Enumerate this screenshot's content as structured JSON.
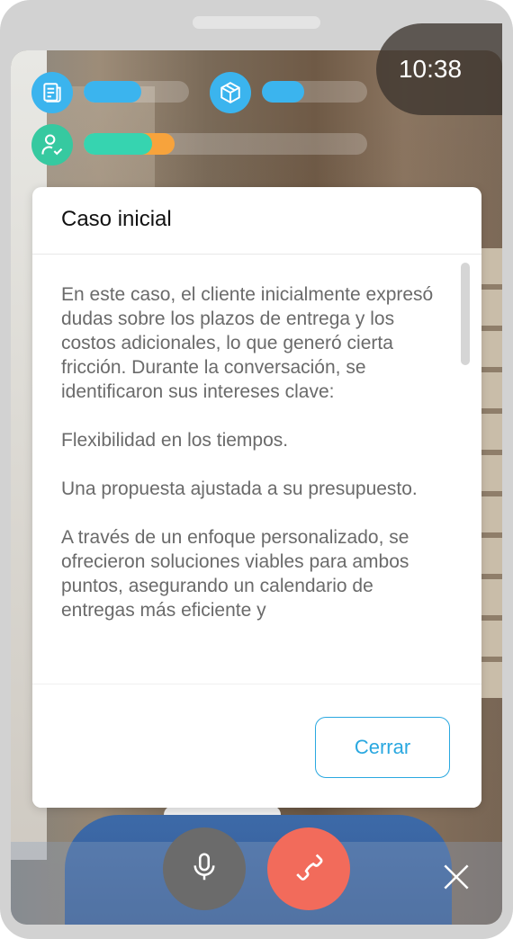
{
  "timer": {
    "text": "10:38"
  },
  "hud": {
    "doc_progress": 0.55,
    "box_progress": 0.4,
    "user_progress": {
      "primary": 0.24,
      "secondary": 0.08
    },
    "colors": {
      "icon_blue": "#3bb4ee",
      "icon_green": "#36c9a0",
      "bar_blue": "#3bb4ee",
      "bar_green": "#36d4b0",
      "bar_orange": "#f7a33c"
    },
    "icons": [
      "document-icon",
      "box-icon",
      "user-check-icon"
    ]
  },
  "modal": {
    "title": "Caso inicial",
    "paragraphs": [
      "En este caso, el cliente inicialmente expresó dudas sobre los plazos de entrega y los costos adicionales, lo que generó cierta fricción. Durante la conversación, se identificaron sus intereses clave:",
      "Flexibilidad en los tiempos.",
      "Una propuesta ajustada a su presupuesto.",
      "A través de un enfoque personalizado, se ofrecieron soluciones viables para ambos puntos, asegurando un calendario de entregas más eficiente y"
    ],
    "close_label": "Cerrar"
  },
  "controls": {
    "icons": [
      "microphone-icon",
      "hang-up-icon",
      "close-icon"
    ],
    "colors": {
      "mic": "#6b6b6b",
      "hangup": "#f26b5b"
    }
  }
}
